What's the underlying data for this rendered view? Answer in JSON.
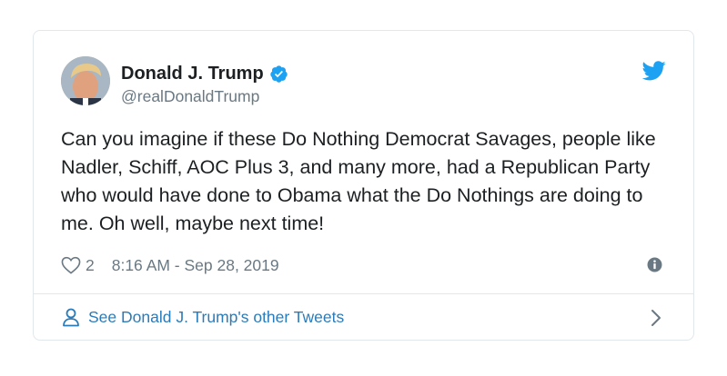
{
  "author": {
    "name": "Donald J. Trump",
    "handle": "@realDonaldTrump",
    "verified": true,
    "avatar_icon": "profile-photo"
  },
  "tweet": {
    "text": "Can you imagine if these Do Nothing Democrat Savages, people like Nadler, Schiff, AOC Plus 3, and many more, had a Republican Party who would have done to Obama what the Do Nothings are doing to me. Oh well, maybe next time!",
    "like_count": "2",
    "timestamp": "8:16 AM - Sep 28, 2019"
  },
  "footer": {
    "link_text": "See Donald J. Trump's other Tweets"
  },
  "icons": {
    "brand": "twitter-bird-icon",
    "verified": "verified-badge-icon",
    "like": "heart-icon",
    "info": "info-icon",
    "person": "person-icon",
    "chevron": "chevron-right-icon"
  },
  "colors": {
    "twitter_blue": "#1da1f2",
    "link_blue": "#2b7bb9",
    "meta_gray": "#697882",
    "border": "#e1e8ed",
    "text": "#1c2022"
  }
}
